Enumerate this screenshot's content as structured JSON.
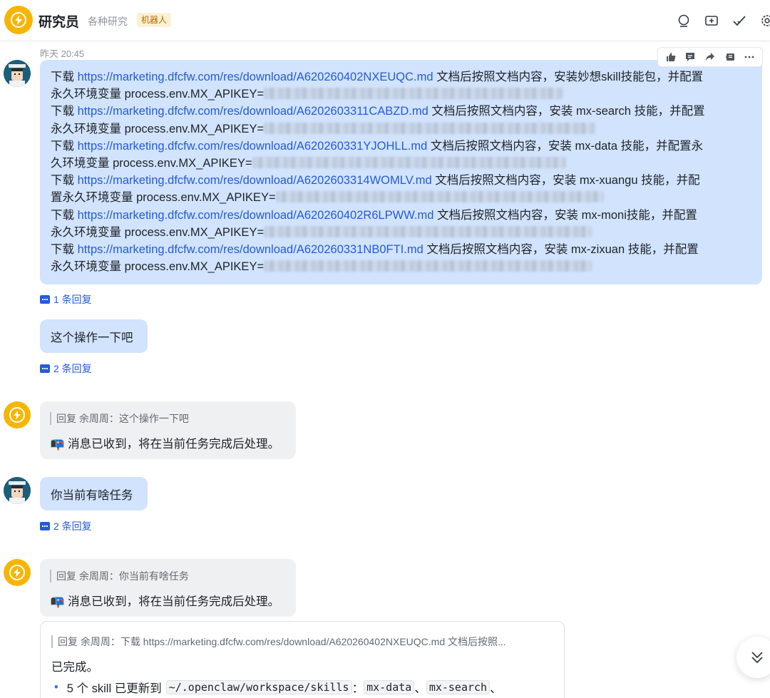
{
  "header": {
    "title": "研究员",
    "subtitle": "各种研究",
    "tag": "机器人"
  },
  "timestamp": "昨天 20:45",
  "first_message": {
    "lines": [
      {
        "pre": "下载 ",
        "link": "https://marketing.dfcfw.com/res/download/A620260402NXEUQC.md",
        "post": " 文档后按照文档内容，安装妙想skill技能包，并配置"
      },
      {
        "pre": "永久环境变量 process.env.MX_APIKEY=",
        "link": "",
        "post": ""
      },
      {
        "pre": "下载 ",
        "link": "https://marketing.dfcfw.com/res/download/A6202603311CABZD.md",
        "post": " 文档后按照文档内容，安装 mx-search 技能，并配置"
      },
      {
        "pre": "永久环境变量 process.env.MX_APIKEY=",
        "link": "",
        "post": ""
      },
      {
        "pre": "下载 ",
        "link": "https://marketing.dfcfw.com/res/download/A620260331YJOHLL.md",
        "post": " 文档后按照文档内容，安装 mx-data 技能，并配置永"
      },
      {
        "pre": "久环境变量 process.env.MX_APIKEY=",
        "link": "",
        "post": ""
      },
      {
        "pre": "下载 ",
        "link": "https://marketing.dfcfw.com/res/download/A6202603314WOMLV.md",
        "post": " 文档后按照文档内容，安装 mx-xuangu 技能，并配"
      },
      {
        "pre": "置永久环境变量 process.env.MX_APIKEY=",
        "link": "",
        "post": ""
      },
      {
        "pre": "下载 ",
        "link": "https://marketing.dfcfw.com/res/download/A620260402R6LPWW.md",
        "post": " 文档后按照文档内容，安装 mx-moni技能，并配置"
      },
      {
        "pre": "永久环境变量 process.env.MX_APIKEY=",
        "link": "",
        "post": ""
      },
      {
        "pre": "下载 ",
        "link": "https://marketing.dfcfw.com/res/download/A620260331NB0FTI.md",
        "post": " 文档后按照文档内容，安装 mx-zixuan 技能，并配置"
      },
      {
        "pre": "永久环境变量 process.env.MX_APIKEY=",
        "link": "",
        "post": ""
      }
    ],
    "reply_count": "1 条回复"
  },
  "msg2": {
    "text": "这个操作一下吧",
    "reply_count": "2 条回复"
  },
  "bot_reply1": {
    "quote": "回复 余周周：这个操作一下吧",
    "text": "📭 消息已收到，将在当前任务完成后处理。"
  },
  "msg3": {
    "text": "你当前有啥任务",
    "reply_count": "2 条回复"
  },
  "bot_reply2": {
    "quote": "回复 余周周：你当前有啥任务",
    "text": "📭 消息已收到，将在当前任务完成后处理。"
  },
  "bot_reply3": {
    "quote": "回复 余周周：下载 https://marketing.dfcfw.com/res/download/A620260402NXEUQC.md 文档后按照...",
    "done": "已完成。",
    "bullet_pre": "5 个 skill 已更新到",
    "code1": "~/.openclaw/workspace/skills",
    "sep1": "：",
    "code2": "mx-data",
    "sep2": "、",
    "code3": "mx-search",
    "sep3": "、"
  }
}
